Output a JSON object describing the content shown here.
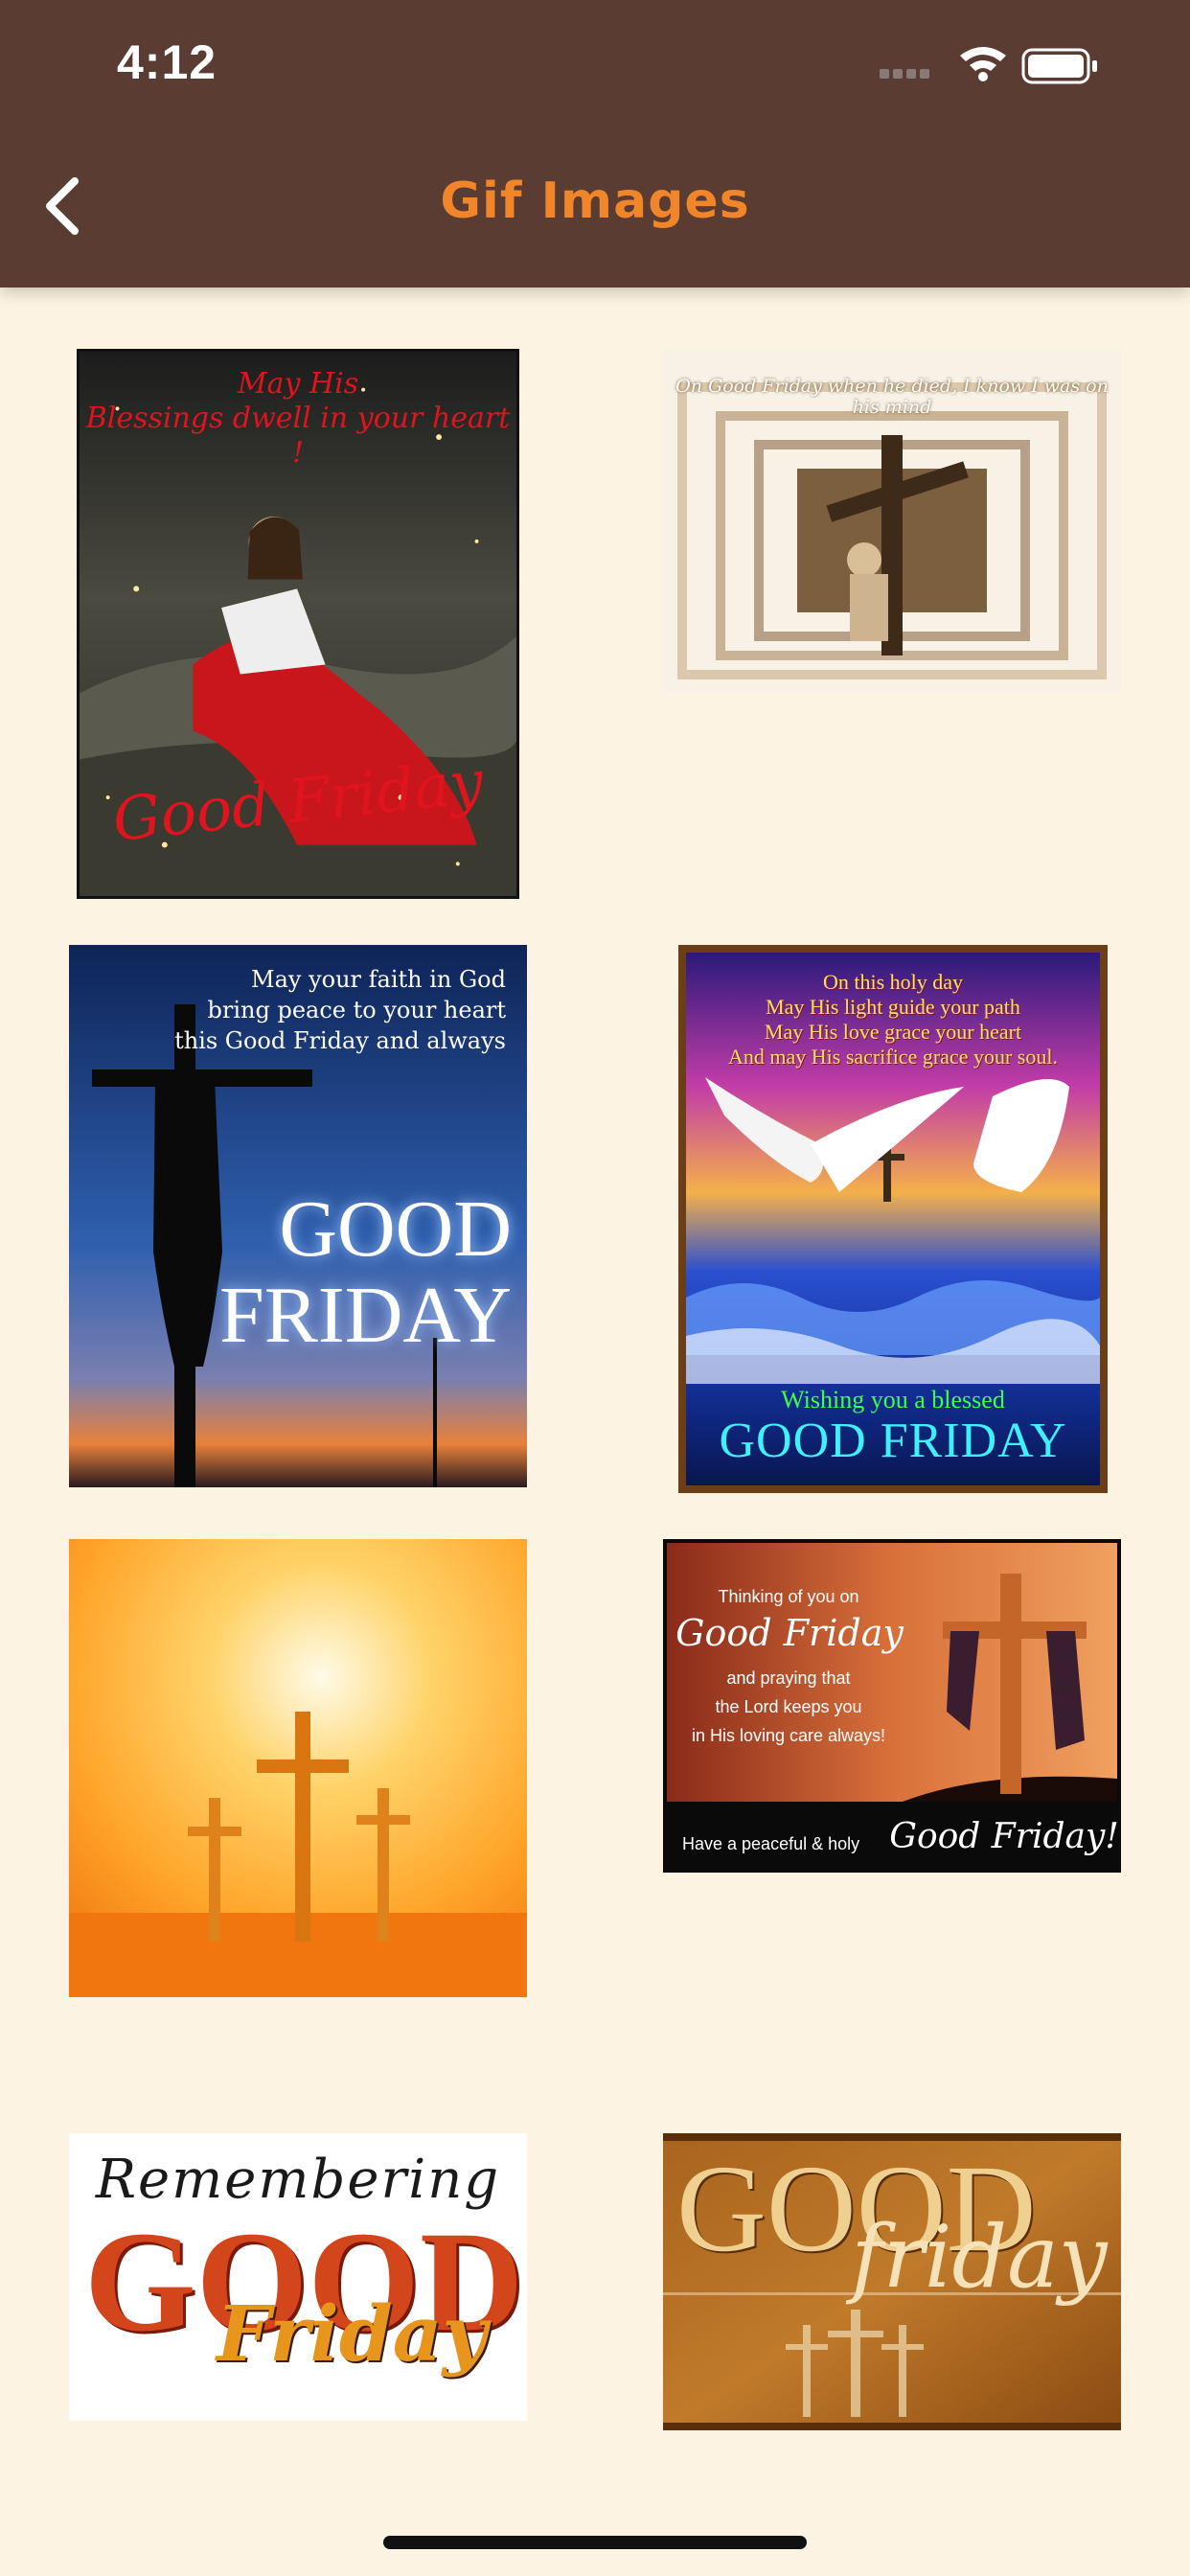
{
  "status_bar": {
    "time": "4:12"
  },
  "header": {
    "title": "Gif Images",
    "back_icon": "chevron-left-icon"
  },
  "colors": {
    "header_bg": "#5B3C33",
    "title": "#F1852A",
    "page_bg": "#FDF3E3"
  },
  "gifs": [
    {
      "top": "May His\nBlessings dwell in your heart !",
      "bottom": "Good Friday"
    },
    {
      "top": "On Good Friday when he died, I know I was on his mind"
    },
    {
      "top": "May your faith in God\nbring peace to your heart\nthis Good Friday and always",
      "bottom": "GOOD\nFRIDAY"
    },
    {
      "top": "On this holy day\nMay His light guide your path\nMay His love grace your heart\nAnd may His sacrifice grace your soul.",
      "sub": "Wishing you a blessed",
      "bottom": "GOOD FRIDAY"
    },
    {},
    {
      "top": "Thinking of you on",
      "script": "Good Friday",
      "body": "and praying that\nthe Lord keeps you\nin His loving care always!",
      "small": "Have a peaceful & holy",
      "bottom": "Good Friday!"
    },
    {
      "top": "Remembering",
      "bottom": "GOOD",
      "script": "Friday"
    },
    {
      "top": "GOOD",
      "script": "friday"
    }
  ]
}
